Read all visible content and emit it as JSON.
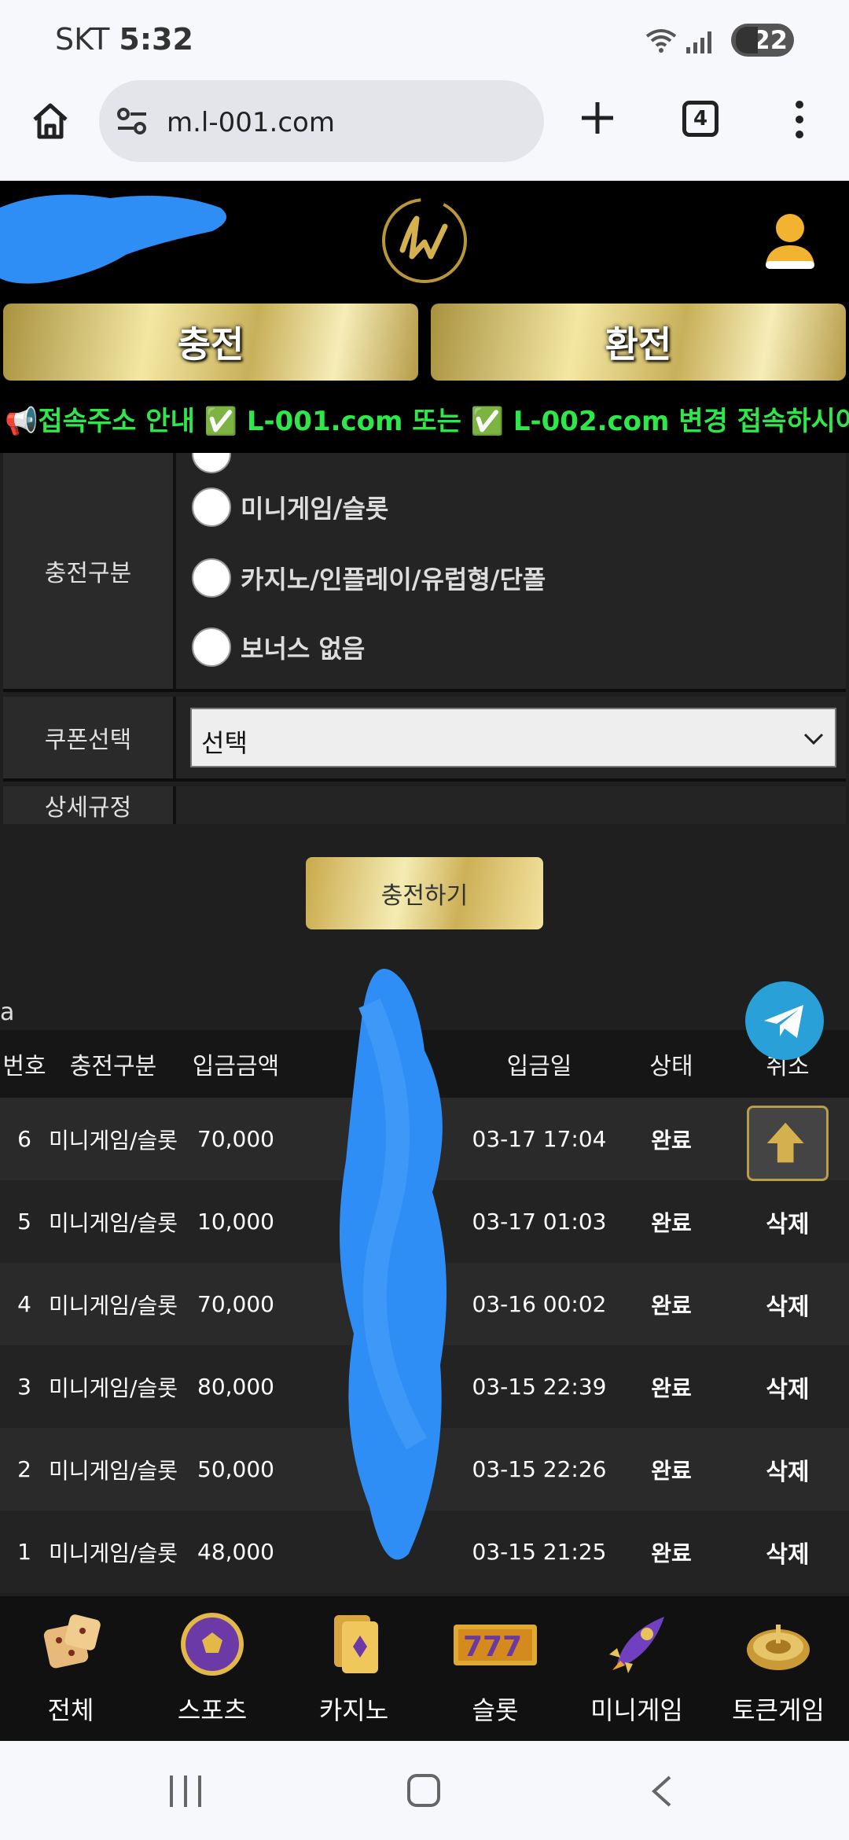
{
  "status_bar": {
    "carrier": "SKT",
    "time": "5:32",
    "battery": "22"
  },
  "browser": {
    "url": "m.l-001.com",
    "tab_count": "4"
  },
  "header": {
    "charge_button": "충전",
    "exchange_button": "환전",
    "notice": "📢접속주소 안내 ✅ L-001.com 또는 ✅ L-002.com 변경 접속하시어 이용에 불편"
  },
  "form": {
    "charge_type_label": "충전구분",
    "radio_options": [
      "미니게임/슬롯",
      "카지노/인플레이/유럽형/단폴",
      "보너스 없음"
    ],
    "coupon_label": "쿠폰선택",
    "coupon_value": "선택",
    "rules_label": "상세규정",
    "submit_label": "충전하기",
    "stray_text": "a"
  },
  "history": {
    "headers": {
      "no": "번호",
      "type": "충전구분",
      "amount": "입금금액",
      "date": "입금일",
      "status": "상태",
      "action": "취소"
    },
    "rows": [
      {
        "no": "6",
        "type": "미니게임/슬롯",
        "amount": "70,000",
        "date": "03-17 17:04",
        "status": "완료",
        "action": ""
      },
      {
        "no": "5",
        "type": "미니게임/슬롯",
        "amount": "10,000",
        "date": "03-17 01:03",
        "status": "완료",
        "action": "삭제"
      },
      {
        "no": "4",
        "type": "미니게임/슬롯",
        "amount": "70,000",
        "date": "03-16 00:02",
        "status": "완료",
        "action": "삭제"
      },
      {
        "no": "3",
        "type": "미니게임/슬롯",
        "amount": "80,000",
        "date": "03-15 22:39",
        "status": "완료",
        "action": "삭제"
      },
      {
        "no": "2",
        "type": "미니게임/슬롯",
        "amount": "50,000",
        "date": "03-15 22:26",
        "status": "완료",
        "action": "삭제"
      },
      {
        "no": "1",
        "type": "미니게임/슬롯",
        "amount": "48,000",
        "date": "03-15 21:25",
        "status": "완료",
        "action": "삭제"
      }
    ]
  },
  "categories": [
    {
      "label": "전체",
      "icon": "dice-icon"
    },
    {
      "label": "스포츠",
      "icon": "soccer-ball-icon"
    },
    {
      "label": "카지노",
      "icon": "cards-icon"
    },
    {
      "label": "슬롯",
      "icon": "slot-777-icon"
    },
    {
      "label": "미니게임",
      "icon": "rocket-icon"
    },
    {
      "label": "토큰게임",
      "icon": "roulette-icon"
    }
  ],
  "colors": {
    "gold": "#d9c068",
    "notice_green": "#2ee84a",
    "telegram_blue": "#29a0d8",
    "scribble_blue": "#2f8ef5"
  }
}
